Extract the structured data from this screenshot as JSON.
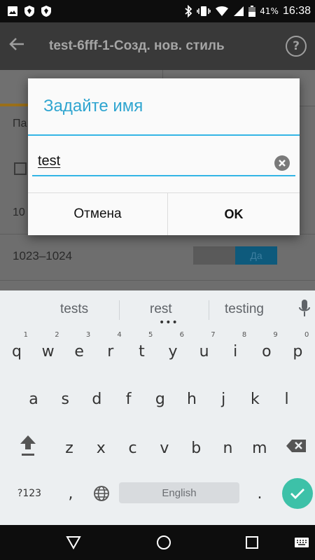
{
  "status_bar": {
    "battery_percent": "41%",
    "time": "16:38"
  },
  "app_bar": {
    "title": "test-6fff-1-Созд. нов. стиль",
    "help_label": "?"
  },
  "background": {
    "label_partial": "Па",
    "row_partial": "10",
    "range_text": "1023–1024",
    "toggle_label": "Да"
  },
  "dialog": {
    "title": "Задайте имя",
    "input_value": "test",
    "cancel_label": "Отмена",
    "ok_label": "OK"
  },
  "keyboard": {
    "suggestions": [
      "tests",
      "rest",
      "testing"
    ],
    "row1": [
      {
        "k": "q",
        "h": "1"
      },
      {
        "k": "w",
        "h": "2"
      },
      {
        "k": "e",
        "h": "3"
      },
      {
        "k": "r",
        "h": "4"
      },
      {
        "k": "t",
        "h": "5"
      },
      {
        "k": "y",
        "h": "6"
      },
      {
        "k": "u",
        "h": "7"
      },
      {
        "k": "i",
        "h": "8"
      },
      {
        "k": "o",
        "h": "9"
      },
      {
        "k": "p",
        "h": "0"
      }
    ],
    "row2": [
      "a",
      "s",
      "d",
      "f",
      "g",
      "h",
      "j",
      "k",
      "l"
    ],
    "row3": [
      "z",
      "x",
      "c",
      "v",
      "b",
      "n",
      "m"
    ],
    "symbols_label": "?123",
    "comma_label": ",",
    "period_label": ".",
    "space_label": "English"
  },
  "colors": {
    "accent": "#33b5e5",
    "enter": "#3dc1a8",
    "toggle_on": "#0e5a7c"
  },
  "icons": [
    "image-icon",
    "shield-icon",
    "bluetooth-icon",
    "vibrate-icon",
    "wifi-icon",
    "signal-icon",
    "battery-icon",
    "back-arrow-icon",
    "help-icon",
    "clear-icon",
    "mic-icon",
    "shift-icon",
    "backspace-icon",
    "globe-icon",
    "check-icon",
    "nav-back-icon",
    "nav-home-icon",
    "nav-recents-icon",
    "keyboard-icon"
  ]
}
